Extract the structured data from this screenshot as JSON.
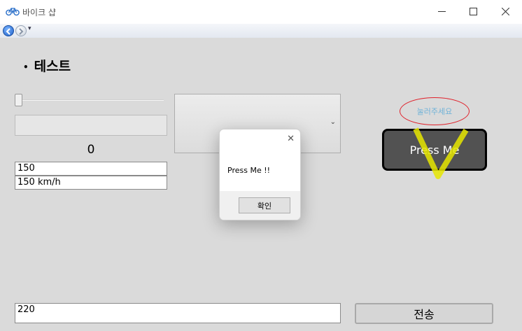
{
  "window": {
    "title": "바이크 샵",
    "icon": "bicycle-icon"
  },
  "nav": {
    "back_icon": "back-arrow-icon",
    "forward_icon": "forward-arrow-icon",
    "dropdown_icon": "chevron-down-icon"
  },
  "main": {
    "heading": "테스트",
    "slider_value": 0,
    "counter": "0",
    "textbox_1": "150",
    "textbox_2": "150 km/h",
    "bottom_textbox": "220",
    "send_button": "전송"
  },
  "dialog": {
    "message": "Press Me !!",
    "ok_button": "확인"
  },
  "right": {
    "ellipse_label": "눌러주세요",
    "press_button": "Press Me"
  },
  "colors": {
    "ellipse_border": "#e0202a",
    "ellipse_text": "#6fb2d8",
    "v_shape": "#e6e600",
    "press_bg": "#464646"
  }
}
